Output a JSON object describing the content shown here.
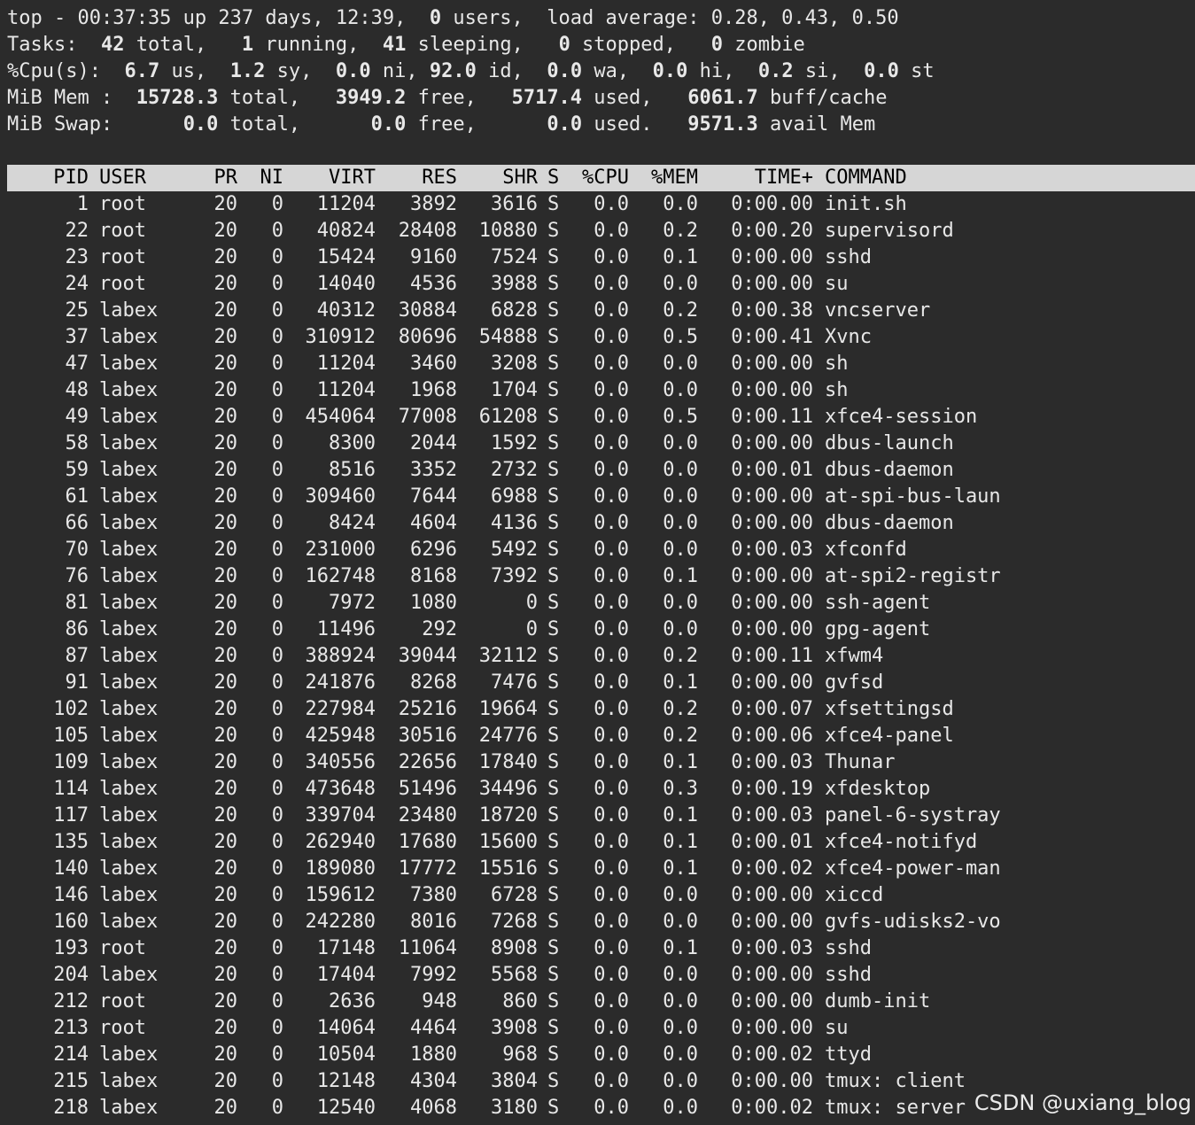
{
  "summary": {
    "l1": {
      "a": "top - 00:37:35 up 237 days, 12:39,  ",
      "users": "0",
      "b": " users,  load average: 0.28, 0.43, 0.50"
    },
    "l2": {
      "a": "Tasks: ",
      "total": " 42",
      "b": " total,   ",
      "running": "1",
      "c": " running,  ",
      "sleeping": "41",
      "d": " sleeping,   ",
      "stopped": "0",
      "e": " stopped,   ",
      "zombie": "0",
      "f": " zombie"
    },
    "l3": {
      "a": "%Cpu(s):  ",
      "us": "6.7",
      "b": " us,  ",
      "sy": "1.2",
      "c": " sy,  ",
      "ni": "0.0",
      "d": " ni, ",
      "id": "92.0",
      "e": " id,  ",
      "wa": "0.0",
      "f": " wa,  ",
      "hi": "0.0",
      "g": " hi,  ",
      "si": "0.2",
      "h": " si,  ",
      "st": "0.0",
      "i": " st"
    },
    "l4": {
      "a": "MiB Mem :  ",
      "total": "15728.3",
      "b": " total,   ",
      "free": "3949.2",
      "c": " free,   ",
      "used": "5717.4",
      "d": " used,   ",
      "buff": "6061.7",
      "e": " buff/cache"
    },
    "l5": {
      "a": "MiB Swap:      ",
      "total": "0.0",
      "b": " total,      ",
      "free": "0.0",
      "c": " free,      ",
      "used": "0.0",
      "d": " used.   ",
      "avail": "9571.3",
      "e": " avail Mem"
    }
  },
  "columns": {
    "pid": "PID",
    "user": "USER",
    "pr": "PR",
    "ni": "NI",
    "virt": "VIRT",
    "res": "RES",
    "shr": "SHR",
    "s": "S",
    "cpu": "%CPU",
    "mem": "%MEM",
    "time": "TIME+",
    "command": "COMMAND"
  },
  "processes": [
    {
      "pid": "1",
      "user": "root",
      "pr": "20",
      "ni": "0",
      "virt": "11204",
      "res": "3892",
      "shr": "3616",
      "s": "S",
      "cpu": "0.0",
      "mem": "0.0",
      "time": "0:00.00",
      "command": "init.sh"
    },
    {
      "pid": "22",
      "user": "root",
      "pr": "20",
      "ni": "0",
      "virt": "40824",
      "res": "28408",
      "shr": "10880",
      "s": "S",
      "cpu": "0.0",
      "mem": "0.2",
      "time": "0:00.20",
      "command": "supervisord"
    },
    {
      "pid": "23",
      "user": "root",
      "pr": "20",
      "ni": "0",
      "virt": "15424",
      "res": "9160",
      "shr": "7524",
      "s": "S",
      "cpu": "0.0",
      "mem": "0.1",
      "time": "0:00.00",
      "command": "sshd"
    },
    {
      "pid": "24",
      "user": "root",
      "pr": "20",
      "ni": "0",
      "virt": "14040",
      "res": "4536",
      "shr": "3988",
      "s": "S",
      "cpu": "0.0",
      "mem": "0.0",
      "time": "0:00.00",
      "command": "su"
    },
    {
      "pid": "25",
      "user": "labex",
      "pr": "20",
      "ni": "0",
      "virt": "40312",
      "res": "30884",
      "shr": "6828",
      "s": "S",
      "cpu": "0.0",
      "mem": "0.2",
      "time": "0:00.38",
      "command": "vncserver"
    },
    {
      "pid": "37",
      "user": "labex",
      "pr": "20",
      "ni": "0",
      "virt": "310912",
      "res": "80696",
      "shr": "54888",
      "s": "S",
      "cpu": "0.0",
      "mem": "0.5",
      "time": "0:00.41",
      "command": "Xvnc"
    },
    {
      "pid": "47",
      "user": "labex",
      "pr": "20",
      "ni": "0",
      "virt": "11204",
      "res": "3460",
      "shr": "3208",
      "s": "S",
      "cpu": "0.0",
      "mem": "0.0",
      "time": "0:00.00",
      "command": "sh"
    },
    {
      "pid": "48",
      "user": "labex",
      "pr": "20",
      "ni": "0",
      "virt": "11204",
      "res": "1968",
      "shr": "1704",
      "s": "S",
      "cpu": "0.0",
      "mem": "0.0",
      "time": "0:00.00",
      "command": "sh"
    },
    {
      "pid": "49",
      "user": "labex",
      "pr": "20",
      "ni": "0",
      "virt": "454064",
      "res": "77008",
      "shr": "61208",
      "s": "S",
      "cpu": "0.0",
      "mem": "0.5",
      "time": "0:00.11",
      "command": "xfce4-session"
    },
    {
      "pid": "58",
      "user": "labex",
      "pr": "20",
      "ni": "0",
      "virt": "8300",
      "res": "2044",
      "shr": "1592",
      "s": "S",
      "cpu": "0.0",
      "mem": "0.0",
      "time": "0:00.00",
      "command": "dbus-launch"
    },
    {
      "pid": "59",
      "user": "labex",
      "pr": "20",
      "ni": "0",
      "virt": "8516",
      "res": "3352",
      "shr": "2732",
      "s": "S",
      "cpu": "0.0",
      "mem": "0.0",
      "time": "0:00.01",
      "command": "dbus-daemon"
    },
    {
      "pid": "61",
      "user": "labex",
      "pr": "20",
      "ni": "0",
      "virt": "309460",
      "res": "7644",
      "shr": "6988",
      "s": "S",
      "cpu": "0.0",
      "mem": "0.0",
      "time": "0:00.00",
      "command": "at-spi-bus-laun"
    },
    {
      "pid": "66",
      "user": "labex",
      "pr": "20",
      "ni": "0",
      "virt": "8424",
      "res": "4604",
      "shr": "4136",
      "s": "S",
      "cpu": "0.0",
      "mem": "0.0",
      "time": "0:00.00",
      "command": "dbus-daemon"
    },
    {
      "pid": "70",
      "user": "labex",
      "pr": "20",
      "ni": "0",
      "virt": "231000",
      "res": "6296",
      "shr": "5492",
      "s": "S",
      "cpu": "0.0",
      "mem": "0.0",
      "time": "0:00.03",
      "command": "xfconfd"
    },
    {
      "pid": "76",
      "user": "labex",
      "pr": "20",
      "ni": "0",
      "virt": "162748",
      "res": "8168",
      "shr": "7392",
      "s": "S",
      "cpu": "0.0",
      "mem": "0.1",
      "time": "0:00.00",
      "command": "at-spi2-registr"
    },
    {
      "pid": "81",
      "user": "labex",
      "pr": "20",
      "ni": "0",
      "virt": "7972",
      "res": "1080",
      "shr": "0",
      "s": "S",
      "cpu": "0.0",
      "mem": "0.0",
      "time": "0:00.00",
      "command": "ssh-agent"
    },
    {
      "pid": "86",
      "user": "labex",
      "pr": "20",
      "ni": "0",
      "virt": "11496",
      "res": "292",
      "shr": "0",
      "s": "S",
      "cpu": "0.0",
      "mem": "0.0",
      "time": "0:00.00",
      "command": "gpg-agent"
    },
    {
      "pid": "87",
      "user": "labex",
      "pr": "20",
      "ni": "0",
      "virt": "388924",
      "res": "39044",
      "shr": "32112",
      "s": "S",
      "cpu": "0.0",
      "mem": "0.2",
      "time": "0:00.11",
      "command": "xfwm4"
    },
    {
      "pid": "91",
      "user": "labex",
      "pr": "20",
      "ni": "0",
      "virt": "241876",
      "res": "8268",
      "shr": "7476",
      "s": "S",
      "cpu": "0.0",
      "mem": "0.1",
      "time": "0:00.00",
      "command": "gvfsd"
    },
    {
      "pid": "102",
      "user": "labex",
      "pr": "20",
      "ni": "0",
      "virt": "227984",
      "res": "25216",
      "shr": "19664",
      "s": "S",
      "cpu": "0.0",
      "mem": "0.2",
      "time": "0:00.07",
      "command": "xfsettingsd"
    },
    {
      "pid": "105",
      "user": "labex",
      "pr": "20",
      "ni": "0",
      "virt": "425948",
      "res": "30516",
      "shr": "24776",
      "s": "S",
      "cpu": "0.0",
      "mem": "0.2",
      "time": "0:00.06",
      "command": "xfce4-panel"
    },
    {
      "pid": "109",
      "user": "labex",
      "pr": "20",
      "ni": "0",
      "virt": "340556",
      "res": "22656",
      "shr": "17840",
      "s": "S",
      "cpu": "0.0",
      "mem": "0.1",
      "time": "0:00.03",
      "command": "Thunar"
    },
    {
      "pid": "114",
      "user": "labex",
      "pr": "20",
      "ni": "0",
      "virt": "473648",
      "res": "51496",
      "shr": "34496",
      "s": "S",
      "cpu": "0.0",
      "mem": "0.3",
      "time": "0:00.19",
      "command": "xfdesktop"
    },
    {
      "pid": "117",
      "user": "labex",
      "pr": "20",
      "ni": "0",
      "virt": "339704",
      "res": "23480",
      "shr": "18720",
      "s": "S",
      "cpu": "0.0",
      "mem": "0.1",
      "time": "0:00.03",
      "command": "panel-6-systray"
    },
    {
      "pid": "135",
      "user": "labex",
      "pr": "20",
      "ni": "0",
      "virt": "262940",
      "res": "17680",
      "shr": "15600",
      "s": "S",
      "cpu": "0.0",
      "mem": "0.1",
      "time": "0:00.01",
      "command": "xfce4-notifyd"
    },
    {
      "pid": "140",
      "user": "labex",
      "pr": "20",
      "ni": "0",
      "virt": "189080",
      "res": "17772",
      "shr": "15516",
      "s": "S",
      "cpu": "0.0",
      "mem": "0.1",
      "time": "0:00.02",
      "command": "xfce4-power-man"
    },
    {
      "pid": "146",
      "user": "labex",
      "pr": "20",
      "ni": "0",
      "virt": "159612",
      "res": "7380",
      "shr": "6728",
      "s": "S",
      "cpu": "0.0",
      "mem": "0.0",
      "time": "0:00.00",
      "command": "xiccd"
    },
    {
      "pid": "160",
      "user": "labex",
      "pr": "20",
      "ni": "0",
      "virt": "242280",
      "res": "8016",
      "shr": "7268",
      "s": "S",
      "cpu": "0.0",
      "mem": "0.0",
      "time": "0:00.00",
      "command": "gvfs-udisks2-vo"
    },
    {
      "pid": "193",
      "user": "root",
      "pr": "20",
      "ni": "0",
      "virt": "17148",
      "res": "11064",
      "shr": "8908",
      "s": "S",
      "cpu": "0.0",
      "mem": "0.1",
      "time": "0:00.03",
      "command": "sshd"
    },
    {
      "pid": "204",
      "user": "labex",
      "pr": "20",
      "ni": "0",
      "virt": "17404",
      "res": "7992",
      "shr": "5568",
      "s": "S",
      "cpu": "0.0",
      "mem": "0.0",
      "time": "0:00.00",
      "command": "sshd"
    },
    {
      "pid": "212",
      "user": "root",
      "pr": "20",
      "ni": "0",
      "virt": "2636",
      "res": "948",
      "shr": "860",
      "s": "S",
      "cpu": "0.0",
      "mem": "0.0",
      "time": "0:00.00",
      "command": "dumb-init"
    },
    {
      "pid": "213",
      "user": "root",
      "pr": "20",
      "ni": "0",
      "virt": "14064",
      "res": "4464",
      "shr": "3908",
      "s": "S",
      "cpu": "0.0",
      "mem": "0.0",
      "time": "0:00.00",
      "command": "su"
    },
    {
      "pid": "214",
      "user": "labex",
      "pr": "20",
      "ni": "0",
      "virt": "10504",
      "res": "1880",
      "shr": "968",
      "s": "S",
      "cpu": "0.0",
      "mem": "0.0",
      "time": "0:00.02",
      "command": "ttyd"
    },
    {
      "pid": "215",
      "user": "labex",
      "pr": "20",
      "ni": "0",
      "virt": "12148",
      "res": "4304",
      "shr": "3804",
      "s": "S",
      "cpu": "0.0",
      "mem": "0.0",
      "time": "0:00.00",
      "command": "tmux: client"
    },
    {
      "pid": "218",
      "user": "labex",
      "pr": "20",
      "ni": "0",
      "virt": "12540",
      "res": "4068",
      "shr": "3180",
      "s": "S",
      "cpu": "0.0",
      "mem": "0.0",
      "time": "0:00.02",
      "command": "tmux: server"
    }
  ],
  "watermark": "CSDN @uxiang_blog"
}
